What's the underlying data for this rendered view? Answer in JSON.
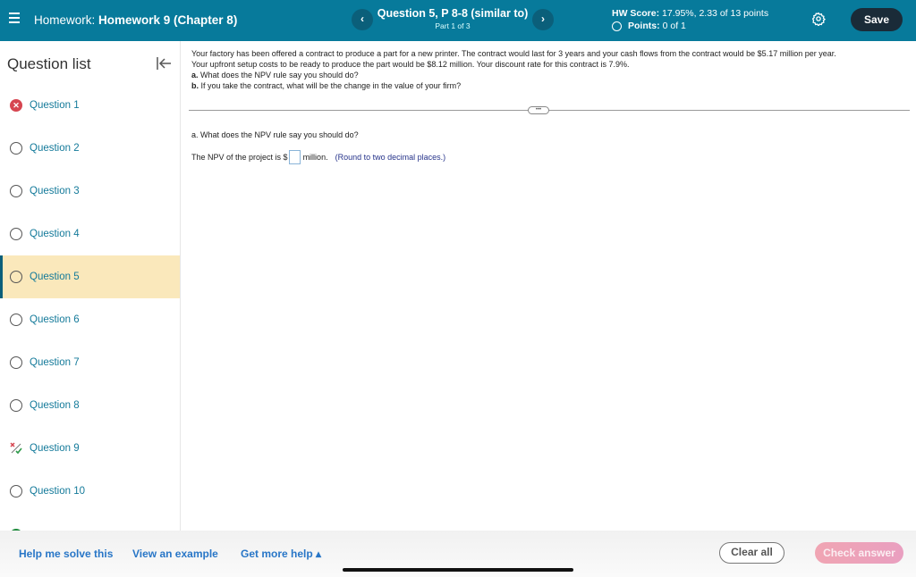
{
  "header": {
    "homework_prefix": "Homework:",
    "homework_title": "Homework 9 (Chapter 8)",
    "question_title": "Question 5, P 8-8 (similar to)",
    "question_part": "Part 1 of 3",
    "prev_label": "‹",
    "next_label": "›",
    "hw_score_label": "HW Score:",
    "hw_score_value": "17.95%, 2.33 of 13 points",
    "points_label": "Points:",
    "points_value": "0 of 1",
    "save_label": "Save"
  },
  "sidebar": {
    "title": "Question list",
    "items": [
      {
        "label": "Question 1",
        "status": "incorrect"
      },
      {
        "label": "Question 2",
        "status": "unanswered"
      },
      {
        "label": "Question 3",
        "status": "unanswered"
      },
      {
        "label": "Question 4",
        "status": "unanswered"
      },
      {
        "label": "Question 5",
        "status": "unanswered",
        "active": true
      },
      {
        "label": "Question 6",
        "status": "unanswered"
      },
      {
        "label": "Question 7",
        "status": "unanswered"
      },
      {
        "label": "Question 8",
        "status": "unanswered"
      },
      {
        "label": "Question 9",
        "status": "partial"
      },
      {
        "label": "Question 10",
        "status": "unanswered"
      }
    ]
  },
  "question": {
    "line1": "Your factory has been offered a contract to produce a part for a new printer. The contract would last for 3 years and your cash flows from the contract would be $5.17 million per year.",
    "line2": "Your upfront setup costs to be ready to produce the part would be $8.12 million. Your discount rate for this contract is 7.9%.",
    "a_label": "a.",
    "a_text": " What does the NPV rule say you should do?",
    "b_label": "b.",
    "b_text": " If you take the contract, what will be the change in the value of your firm?",
    "more_label": "•••",
    "part_a_prompt": "a. What does the NPV rule say you should do?",
    "answer_prefix": "The NPV of the project is $",
    "answer_value": "",
    "answer_suffix": "million.",
    "answer_hint": "(Round to two decimal places.)"
  },
  "footer": {
    "help_solve": "Help me solve this",
    "view_example": "View an example",
    "more_help": "Get more help ▴",
    "clear_all": "Clear all",
    "check_answer": "Check answer"
  },
  "colors": {
    "header_bg": "#077a9b",
    "active_item_bg": "#fae8bb",
    "link": "#2876c7",
    "incorrect": "#d64550",
    "check_button": "#f0a5b3"
  }
}
